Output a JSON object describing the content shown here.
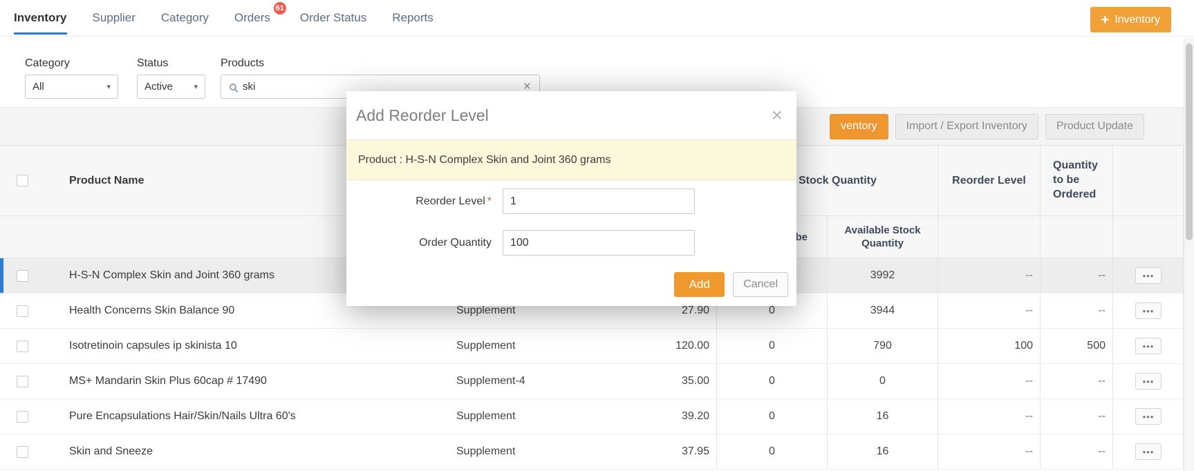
{
  "colors": {
    "accent_orange": "#f0a138",
    "accent_blue": "#2b7cd3",
    "badge_red": "#f2594d",
    "banner_yellow": "#fcf8dc"
  },
  "nav": {
    "tabs": [
      {
        "label": "Inventory"
      },
      {
        "label": "Supplier"
      },
      {
        "label": "Category"
      },
      {
        "label": "Orders",
        "badge": "61"
      },
      {
        "label": "Order Status"
      },
      {
        "label": "Reports"
      }
    ],
    "new_button": {
      "icon": "+",
      "label": "Inventory"
    }
  },
  "filters": {
    "category": {
      "label": "Category",
      "value": "All",
      "caret_icon": "▾"
    },
    "status": {
      "label": "Status",
      "value": "Active",
      "caret_icon": "▾"
    },
    "products": {
      "label": "Products",
      "value": "ski",
      "clear_icon": "×"
    }
  },
  "toolbar": {
    "partial_button_label": "ventory",
    "import_export_label": "Import / Export Inventory",
    "product_update_label": "Product Update"
  },
  "table": {
    "headers": {
      "product_name": "Product Name",
      "stock_quantity_group": "Stock Quantity",
      "reorder_level": "Reorder Level",
      "quantity_to_be_ordered": "Quantity to be Ordered",
      "sub_partial": "be",
      "available_stock_quantity": "Available Stock Quantity"
    },
    "row_action_icon": "•••",
    "rows": [
      {
        "name": "H-S-N Complex Skin and Joint 360 grams",
        "category": "",
        "price": "",
        "qty": "",
        "available": "3992",
        "reorder": "--",
        "to_order": "--"
      },
      {
        "name": "Health Concerns Skin Balance 90",
        "category": "Supplement",
        "price": "27.90",
        "qty": "0",
        "available": "3944",
        "reorder": "--",
        "to_order": "--"
      },
      {
        "name": "Isotretinoin capsules ip skinista 10",
        "category": "Supplement",
        "price": "120.00",
        "qty": "0",
        "available": "790",
        "reorder": "100",
        "to_order": "500"
      },
      {
        "name": "MS+ Mandarin Skin Plus 60cap # 17490",
        "category": "Supplement-4",
        "price": "35.00",
        "qty": "0",
        "available": "0",
        "reorder": "--",
        "to_order": "--"
      },
      {
        "name": "Pure Encapsulations Hair/Skin/Nails Ultra 60's",
        "category": "Supplement",
        "price": "39.20",
        "qty": "0",
        "available": "16",
        "reorder": "--",
        "to_order": "--"
      },
      {
        "name": "Skin and Sneeze",
        "category": "Supplement",
        "price": "37.95",
        "qty": "0",
        "available": "16",
        "reorder": "--",
        "to_order": "--"
      }
    ]
  },
  "modal": {
    "title": "Add Reorder Level",
    "close_icon": "×",
    "product_banner": "Product : H-S-N Complex Skin and Joint 360 grams",
    "fields": {
      "reorder_level": {
        "label": "Reorder Level",
        "required_mark": "*",
        "value": "1"
      },
      "order_quantity": {
        "label": "Order Quantity",
        "value": "100"
      }
    },
    "add_label": "Add",
    "cancel_label": "Cancel"
  }
}
